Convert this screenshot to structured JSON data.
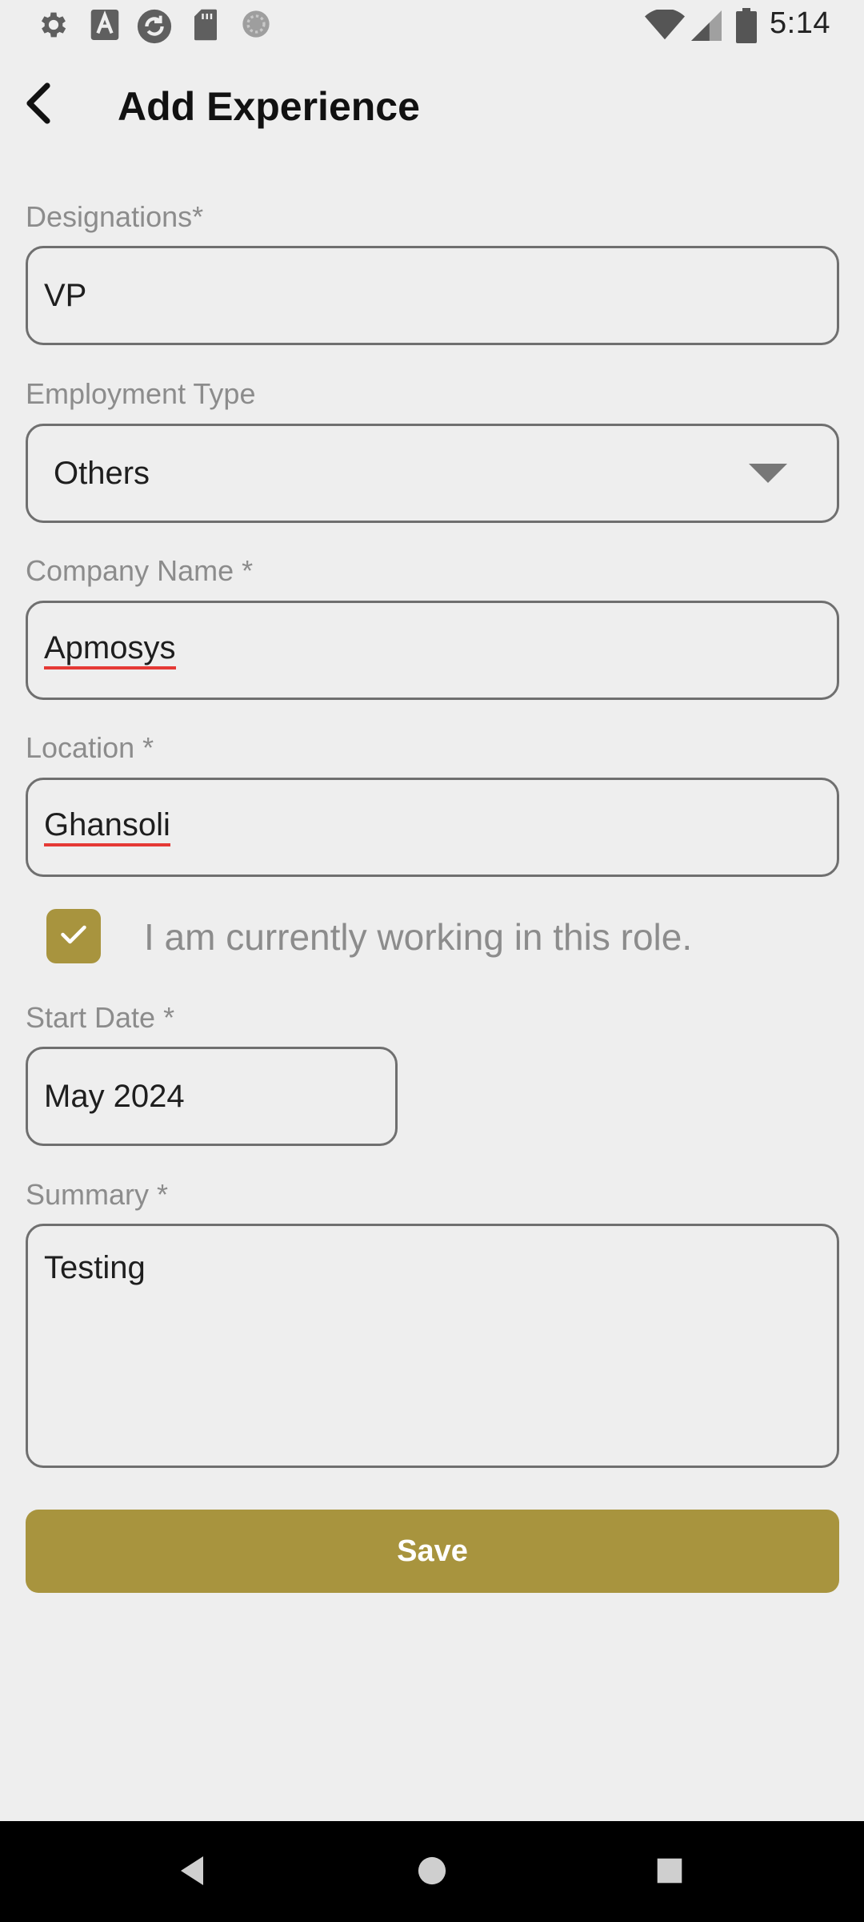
{
  "status_bar": {
    "time": "5:14",
    "left_icons": [
      "settings-icon",
      "font-icon",
      "sync-icon",
      "sd-card-icon",
      "loading-icon"
    ],
    "right_icons": [
      "wifi-icon",
      "cellular-signal-icon",
      "battery-icon"
    ]
  },
  "header": {
    "title": "Add Experience",
    "back_icon": "arrow-back-icon"
  },
  "form": {
    "designation": {
      "label": "Designations*",
      "value": "VP"
    },
    "employment_type": {
      "label": "Employment Type",
      "value": "Others"
    },
    "company_name": {
      "label": "Company Name *",
      "value": "Apmosys"
    },
    "location": {
      "label": "Location *",
      "value": "Ghansoli"
    },
    "currently_working": {
      "label": "I am currently working in this role.",
      "checked": true
    },
    "start_date": {
      "label": "Start Date *",
      "value": "May 2024"
    },
    "summary": {
      "label": "Summary *",
      "value": "Testing"
    },
    "save_label": "Save"
  },
  "colors": {
    "accent": "#a8943e",
    "background": "#eeeeee",
    "border": "#6f6f6f",
    "label": "#8c8c8c",
    "spellcheck": "#e53935"
  },
  "nav_bar": {
    "icons": [
      "nav-back-icon",
      "nav-home-icon",
      "nav-recents-icon"
    ]
  }
}
